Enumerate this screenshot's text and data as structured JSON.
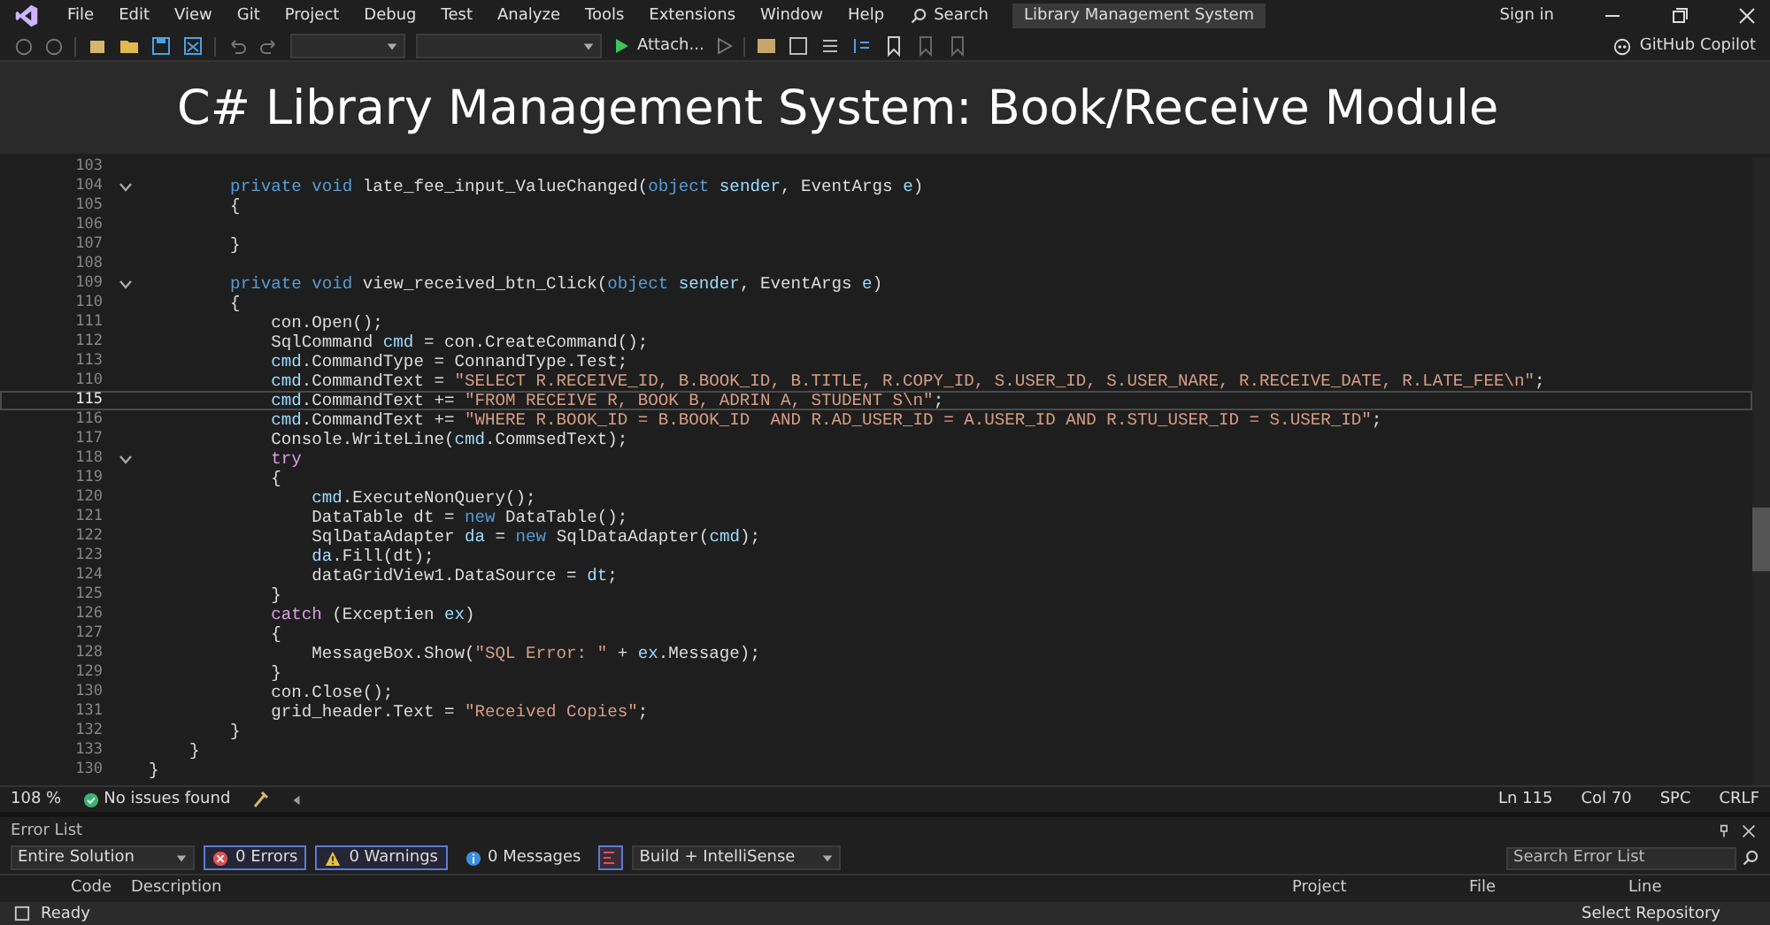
{
  "menu": {
    "items": [
      {
        "label": "File"
      },
      {
        "label": "Edit"
      },
      {
        "label": "View"
      },
      {
        "label": "Git"
      },
      {
        "label": "Project"
      },
      {
        "label": "Debug"
      },
      {
        "label": "Test"
      },
      {
        "label": "Analyze"
      },
      {
        "label": "Tools"
      },
      {
        "label": "Extensions"
      },
      {
        "label": "Window"
      },
      {
        "label": "Help"
      }
    ],
    "search": "Search",
    "solution_title": "Library Management System",
    "sign_in": "Sign in"
  },
  "toolbar": {
    "run_label": "Attach...",
    "copilot": "GitHub Copilot"
  },
  "banner": {
    "title": "C# Library Management System: Book/Receive Module"
  },
  "editor": {
    "lines": [
      {
        "number": "103",
        "current": false,
        "foldable": false
      },
      {
        "number": "104",
        "current": false,
        "foldable": true,
        "tokens": [
          {
            "kind": "kw",
            "text": "        private void"
          },
          {
            "kind": "plain",
            "text": " late_fee_input_ValueChanged("
          },
          {
            "kind": "kw",
            "text": "object"
          },
          {
            "kind": "var",
            "text": " sender"
          },
          {
            "kind": "plain",
            "text": ", EventArgs "
          },
          {
            "kind": "var",
            "text": "e"
          },
          {
            "kind": "plain",
            "text": ")"
          }
        ]
      },
      {
        "number": "105",
        "current": false,
        "foldable": false,
        "tokens": [
          {
            "kind": "plain",
            "text": "        {"
          }
        ]
      },
      {
        "number": "106",
        "current": false,
        "foldable": false
      },
      {
        "number": "107",
        "current": false,
        "foldable": false,
        "tokens": [
          {
            "kind": "plain",
            "text": "        }"
          }
        ]
      },
      {
        "number": "108",
        "current": false,
        "foldable": false
      },
      {
        "number": "109",
        "current": false,
        "foldable": true,
        "tokens": [
          {
            "kind": "kw",
            "text": "        private void"
          },
          {
            "kind": "plain",
            "text": " view_received_btn_Click("
          },
          {
            "kind": "kw",
            "text": "object"
          },
          {
            "kind": "var",
            "text": " sender"
          },
          {
            "kind": "plain",
            "text": ", EventArgs "
          },
          {
            "kind": "var",
            "text": "e"
          },
          {
            "kind": "plain",
            "text": ")"
          }
        ]
      },
      {
        "number": "110",
        "current": false,
        "foldable": false,
        "tokens": [
          {
            "kind": "plain",
            "text": "        {"
          }
        ]
      },
      {
        "number": "111",
        "current": false,
        "foldable": false,
        "tokens": [
          {
            "kind": "plain",
            "text": "            con.Open();"
          }
        ]
      },
      {
        "number": "112",
        "current": false,
        "foldable": false,
        "tokens": [
          {
            "kind": "plain",
            "text": "            SqlCommand "
          },
          {
            "kind": "var",
            "text": "cmd"
          },
          {
            "kind": "plain",
            "text": " = con.CreateCommand();"
          }
        ]
      },
      {
        "number": "113",
        "current": false,
        "foldable": false,
        "tokens": [
          {
            "kind": "var",
            "text": "            cmd"
          },
          {
            "kind": "plain",
            "text": ".CommandType = ConnandType.Test;"
          }
        ]
      },
      {
        "number": "110",
        "current": false,
        "foldable": false,
        "tokens": [
          {
            "kind": "var",
            "text": "            cmd"
          },
          {
            "kind": "plain",
            "text": ".CommandText = "
          },
          {
            "kind": "str",
            "text": "\"SELECT R.RECEIVE_ID, B.BOOK_ID, B.TITLE, R.COPY_ID, S.USER_ID, S.USER_NARE, R.RECEIVE_DATE, R.LATE_FEE\\n\""
          },
          {
            "kind": "plain",
            "text": ";"
          }
        ]
      },
      {
        "number": "115",
        "current": true,
        "foldable": false,
        "tokens": [
          {
            "kind": "var",
            "text": "            cmd"
          },
          {
            "kind": "plain",
            "text": ".CommandText += "
          },
          {
            "kind": "str",
            "text": "\"FROM RECEIVE R, BOOK B, ADRIN A, STUDENT S\\n\""
          },
          {
            "kind": "plain",
            "text": ";"
          }
        ]
      },
      {
        "number": "116",
        "current": false,
        "foldable": false,
        "tokens": [
          {
            "kind": "var",
            "text": "            cmd"
          },
          {
            "kind": "plain",
            "text": ".CommandText += "
          },
          {
            "kind": "str",
            "text": "\"WHERE R.BOOK_ID = B.BOOK_ID  AND R.AD_USER_ID = A.USER_ID AND R.STU_USER_ID = S.USER_ID\""
          },
          {
            "kind": "plain",
            "text": ";"
          }
        ]
      },
      {
        "number": "117",
        "current": false,
        "foldable": false,
        "tokens": [
          {
            "kind": "plain",
            "text": "            Console.WriteLine("
          },
          {
            "kind": "var",
            "text": "cmd"
          },
          {
            "kind": "plain",
            "text": ".CommsedText);"
          }
        ]
      },
      {
        "number": "118",
        "current": false,
        "foldable": true,
        "tokens": [
          {
            "kind": "ctrl",
            "text": "            try"
          }
        ]
      },
      {
        "number": "119",
        "current": false,
        "foldable": false,
        "tokens": [
          {
            "kind": "plain",
            "text": "            {"
          }
        ]
      },
      {
        "number": "120",
        "current": false,
        "foldable": false,
        "tokens": [
          {
            "kind": "var",
            "text": "                cmd"
          },
          {
            "kind": "plain",
            "text": ".ExecuteNonQuery();"
          }
        ]
      },
      {
        "number": "121",
        "current": false,
        "foldable": false,
        "tokens": [
          {
            "kind": "plain",
            "text": "                DataTable dt = "
          },
          {
            "kind": "kw",
            "text": "new"
          },
          {
            "kind": "plain",
            "text": " DataTable();"
          }
        ]
      },
      {
        "number": "122",
        "current": false,
        "foldable": false,
        "tokens": [
          {
            "kind": "plain",
            "text": "                SqlDataAdapter "
          },
          {
            "kind": "var",
            "text": "da"
          },
          {
            "kind": "plain",
            "text": " = "
          },
          {
            "kind": "kw",
            "text": "new"
          },
          {
            "kind": "plain",
            "text": " SqlDataAdapter("
          },
          {
            "kind": "var",
            "text": "cmd"
          },
          {
            "kind": "plain",
            "text": ");"
          }
        ]
      },
      {
        "number": "123",
        "current": false,
        "foldable": false,
        "tokens": [
          {
            "kind": "var",
            "text": "                da"
          },
          {
            "kind": "plain",
            "text": ".Fill(dt);"
          }
        ]
      },
      {
        "number": "124",
        "current": false,
        "foldable": false,
        "tokens": [
          {
            "kind": "plain",
            "text": "                dataGridView1.DataSource = "
          },
          {
            "kind": "var",
            "text": "dt"
          },
          {
            "kind": "plain",
            "text": ";"
          }
        ]
      },
      {
        "number": "125",
        "current": false,
        "foldable": false,
        "tokens": [
          {
            "kind": "plain",
            "text": "            }"
          }
        ]
      },
      {
        "number": "126",
        "current": false,
        "foldable": false,
        "tokens": [
          {
            "kind": "ctrl",
            "text": "            catch"
          },
          {
            "kind": "plain",
            "text": " (Exceptien "
          },
          {
            "kind": "var",
            "text": "ex"
          },
          {
            "kind": "plain",
            "text": ")"
          }
        ]
      },
      {
        "number": "127",
        "current": false,
        "foldable": false,
        "tokens": [
          {
            "kind": "plain",
            "text": "            {"
          }
        ]
      },
      {
        "number": "128",
        "current": false,
        "foldable": false,
        "tokens": [
          {
            "kind": "plain",
            "text": "                MessageBox.Show("
          },
          {
            "kind": "str",
            "text": "\"SQL Error: \""
          },
          {
            "kind": "plain",
            "text": " + "
          },
          {
            "kind": "var",
            "text": "ex"
          },
          {
            "kind": "plain",
            "text": ".Message);"
          }
        ]
      },
      {
        "number": "129",
        "current": false,
        "foldable": false,
        "tokens": [
          {
            "kind": "plain",
            "text": "            }"
          }
        ]
      },
      {
        "number": "130",
        "current": false,
        "foldable": false,
        "tokens": [
          {
            "kind": "plain",
            "text": "            con.Close();"
          }
        ]
      },
      {
        "number": "131",
        "current": false,
        "foldable": false,
        "tokens": [
          {
            "kind": "plain",
            "text": "            grid_header.Text = "
          },
          {
            "kind": "str",
            "text": "\"Received Copies\""
          },
          {
            "kind": "plain",
            "text": ";"
          }
        ]
      },
      {
        "number": "132",
        "current": false,
        "foldable": false,
        "tokens": [
          {
            "kind": "plain",
            "text": "        }"
          }
        ]
      },
      {
        "number": "133",
        "current": false,
        "foldable": false,
        "tokens": [
          {
            "kind": "plain",
            "text": "    }"
          }
        ]
      },
      {
        "number": "130",
        "current": false,
        "foldable": false,
        "tokens": [
          {
            "kind": "plain",
            "text": "}"
          }
        ]
      }
    ]
  },
  "editor_status": {
    "zoom": "108 %",
    "issues": "No issues found",
    "line": "Ln 115",
    "column": "Col 70",
    "whitespace": "SPC",
    "line_ending": "CRLF"
  },
  "error_list": {
    "title": "Error List",
    "scope": "Entire Solution",
    "errors": "0 Errors",
    "warnings": "0 Warnings",
    "messages": "0 Messages",
    "source": "Build + IntelliSense",
    "search": {
      "placeholder": "Search Error List"
    },
    "columns": [
      "Code",
      "Description",
      "Project",
      "File",
      "Line"
    ]
  },
  "status_bar": {
    "state": "Ready",
    "repository": "Select Repository"
  }
}
